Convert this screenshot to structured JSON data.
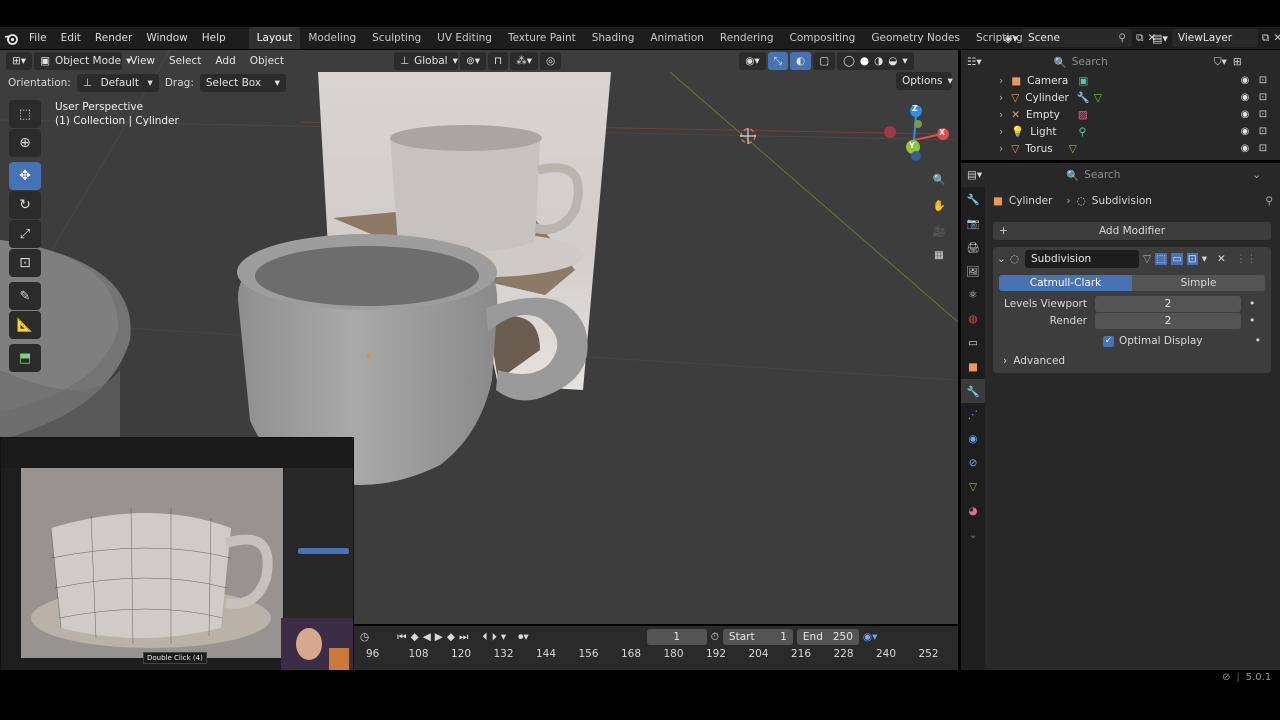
{
  "menu": {
    "items": [
      "File",
      "Edit",
      "Render",
      "Window",
      "Help"
    ]
  },
  "workspaces": [
    "Layout",
    "Modeling",
    "Sculpting",
    "UV Editing",
    "Texture Paint",
    "Shading",
    "Animation",
    "Rendering",
    "Compositing",
    "Geometry Nodes",
    "Scripting"
  ],
  "workspace_add": "+",
  "scene": "Scene",
  "view_layer": "ViewLayer",
  "viewport": {
    "mode": "Object Mode",
    "menus": [
      "View",
      "Select",
      "Add",
      "Object"
    ],
    "transform": "Global",
    "orientation_label": "Orientation:",
    "orientation_value": "Default",
    "drag_label": "Drag:",
    "drag_value": "Select Box",
    "options": "Options",
    "perspective": "User Perspective",
    "collection_info": "(1) Collection | Cylinder",
    "gizmo": {
      "x": "X",
      "y": "Y",
      "z": "Z"
    }
  },
  "timeline": {
    "current_frame": "1",
    "start_label": "Start",
    "start_value": "1",
    "end_label": "End",
    "end_value": "250",
    "ticks": [
      "96",
      "108",
      "120",
      "132",
      "144",
      "156",
      "168",
      "180",
      "192",
      "204",
      "216",
      "228",
      "240",
      "252"
    ]
  },
  "outliner": {
    "search_placeholder": "Search",
    "items": [
      {
        "name": "Camera",
        "color": "#e9995b"
      },
      {
        "name": "Cylinder",
        "color": "#e9995b"
      },
      {
        "name": "Empty",
        "color": "#e9995b"
      },
      {
        "name": "Light",
        "color": "#e9995b"
      },
      {
        "name": "Torus",
        "color": "#e9995b"
      }
    ]
  },
  "properties": {
    "search_placeholder": "Search",
    "breadcrumb_object": "Cylinder",
    "breadcrumb_modifier": "Subdivision",
    "add_modifier": "Add Modifier",
    "modifier_name": "Subdivision",
    "catmull": "Catmull-Clark",
    "simple": "Simple",
    "levels_label": "Levels Viewport",
    "levels_value": "2",
    "render_label": "Render",
    "render_value": "2",
    "optimal_display": "Optimal Display",
    "advanced": "Advanced"
  },
  "pip": {
    "tooltip": "Double Click (4)"
  },
  "status": {
    "version": "5.0.1"
  },
  "colors": {
    "accent": "#4772b3",
    "x_axis": "#e74a4a",
    "y_axis": "#8cc63e",
    "z_axis": "#2d8fe8"
  }
}
